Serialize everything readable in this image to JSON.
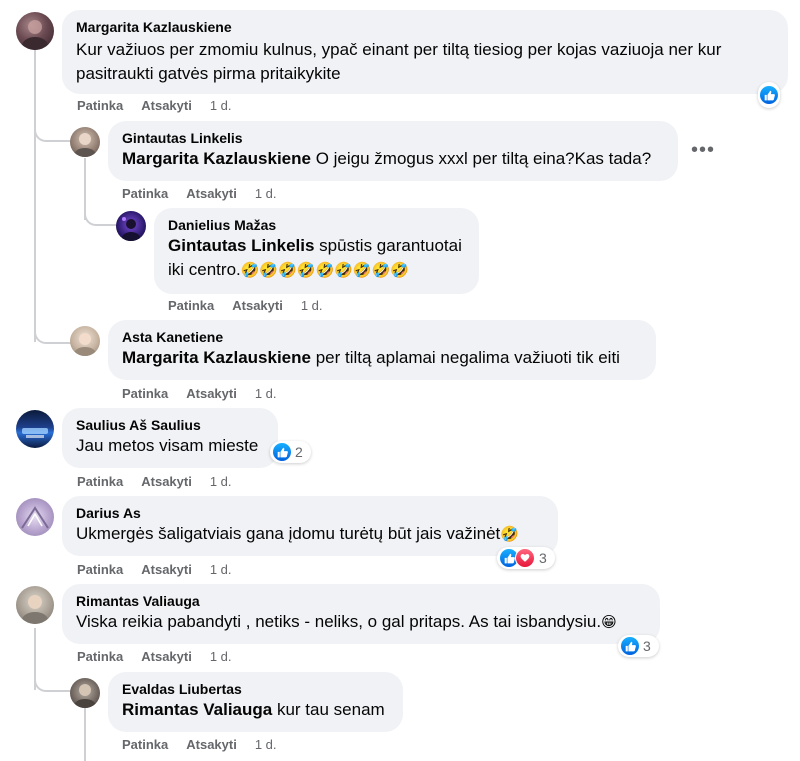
{
  "actions": {
    "like": "Patinka",
    "reply": "Atsakyti"
  },
  "comments": [
    {
      "author": "Margarita Kazlauskiene",
      "text": "Kur važiuos per zmomiu kulnus, ypač einant per tiltą tiesiog per kojas vaziuoja ner kur pasitraukti gatvės pirma pritaikykite",
      "time": "1 d.",
      "reactions": {
        "types": [
          "like"
        ],
        "count": ""
      },
      "replies": [
        {
          "author": "Gintautas Linkelis",
          "mention": "Margarita Kazlauskiene",
          "text": "O jeigu žmogus xxxl per tiltą eina?Kas tada?",
          "time": "1 d.",
          "replies": [
            {
              "author": "Danielius Mažas",
              "mention": "Gintautas Linkelis",
              "text_line1": "spūstis garantuotai",
              "text_line2": "iki centro.",
              "emojis": "🤣🤣🤣🤣🤣🤣🤣🤣🤣",
              "time": "1 d."
            }
          ]
        },
        {
          "author": "Asta Kanetiene",
          "mention": "Margarita Kazlauskiene",
          "text": "per tiltą aplamai negalima važiuoti tik eiti",
          "time": "1 d."
        }
      ]
    },
    {
      "author": "Saulius Aš Saulius",
      "text": "Jau metos visam mieste",
      "time": "1 d.",
      "reactions": {
        "types": [
          "like"
        ],
        "count": "2"
      }
    },
    {
      "author": "Darius As",
      "text": "Ukmergės šaligatviais gana įdomu turėtų būt jais važinėt",
      "emoji": "🤣",
      "time": "1 d.",
      "reactions": {
        "types": [
          "like",
          "love"
        ],
        "count": "3"
      }
    },
    {
      "author": "Rimantas Valiauga",
      "text": "Viska reikia pabandyti , netiks - neliks, o gal pritaps. As tai isbandysiu.",
      "emoji": "😁",
      "time": "1 d.",
      "reactions": {
        "types": [
          "like"
        ],
        "count": "3"
      },
      "replies": [
        {
          "author": "Evaldas Liubertas",
          "mention": "Rimantas Valiauga",
          "text": "kur tau senam",
          "time": "1 d."
        }
      ]
    }
  ]
}
